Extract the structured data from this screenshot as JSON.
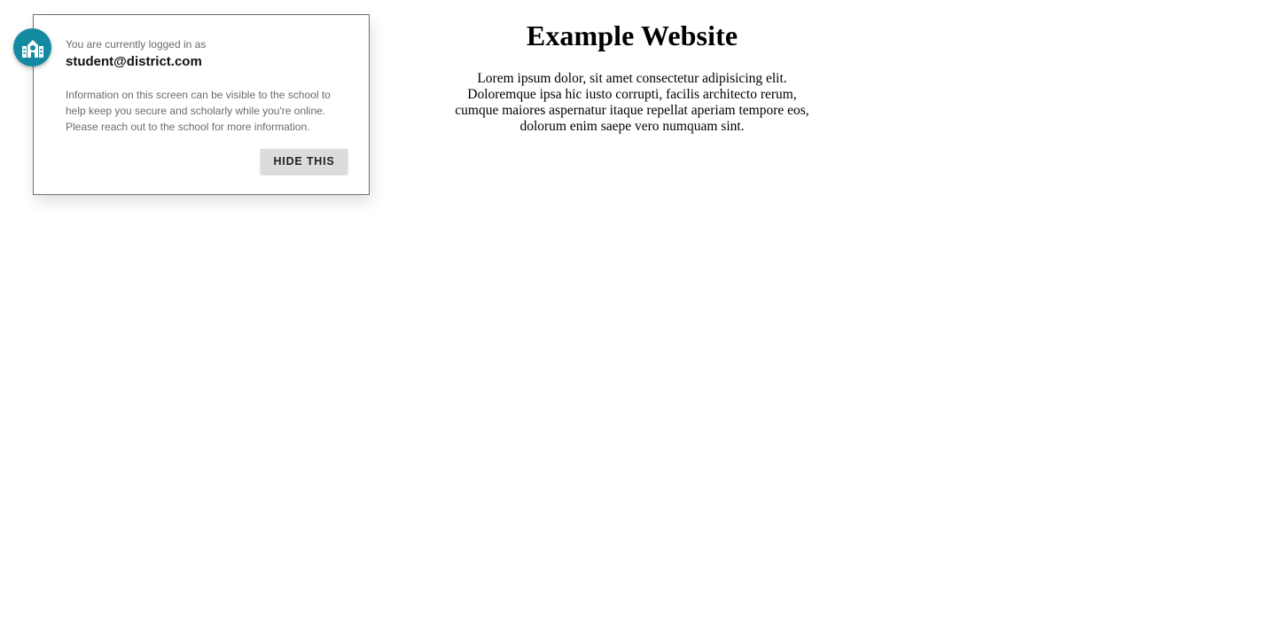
{
  "website": {
    "title": "Example Website",
    "paragraph": "Lorem ipsum dolor, sit amet consectetur adipisicing elit. Doloremque ipsa hic iusto corrupti, facilis architecto rerum, cumque maiores aspernatur itaque repellat aperiam tempore eos, dolorum enim saepe vero numquam sint."
  },
  "notice": {
    "icon": "school-building-icon",
    "accent_color": "#138aa1",
    "logged_in_label": "You are currently logged in as",
    "email": "student@district.com",
    "info": "Information on this screen can be visible to the school to help keep you secure and scholarly while you're online. Please reach out to the school for more information.",
    "hide_label": "HIDE THIS"
  }
}
